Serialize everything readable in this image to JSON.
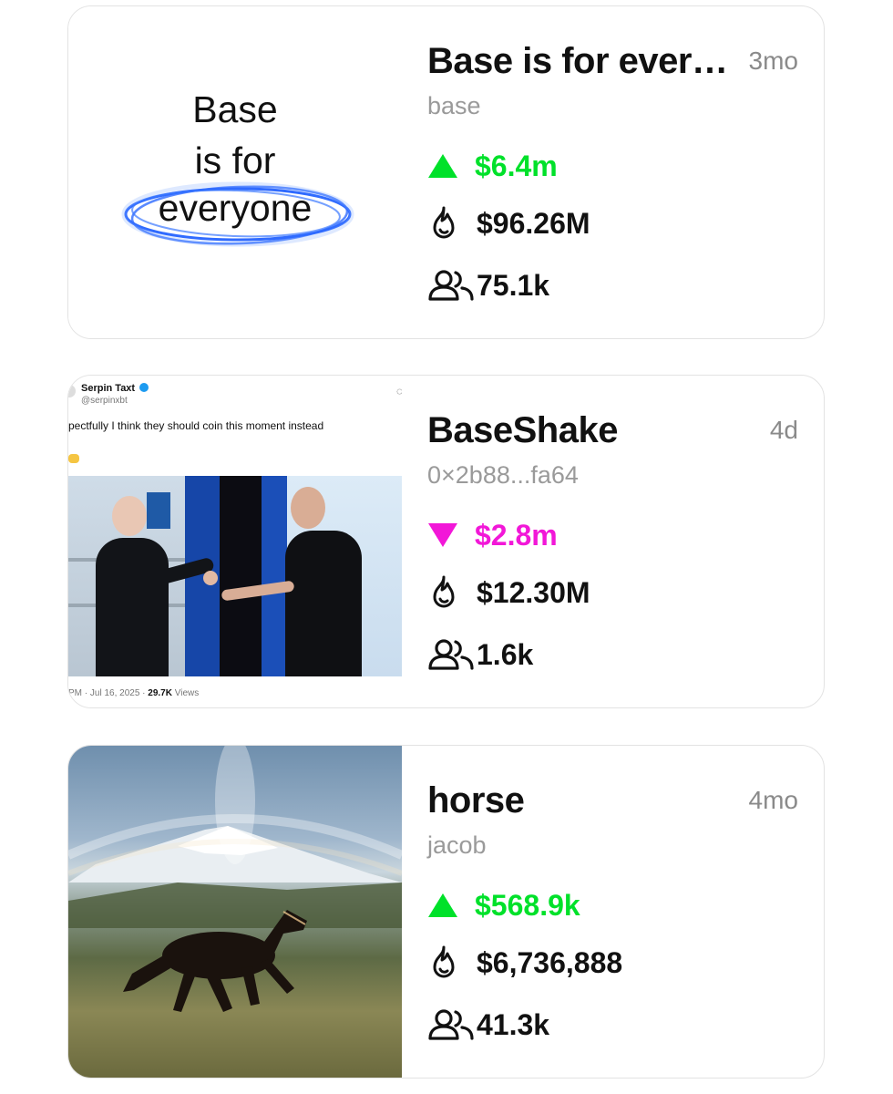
{
  "cards": [
    {
      "title": "Base is for every...",
      "age": "3mo",
      "creator": "base",
      "change": "$6.4m",
      "change_dir": "up",
      "burn": "$96.26M",
      "holders": "75.1k",
      "thumb": {
        "line1": "Base",
        "line2": "is for",
        "line3": "everyone"
      }
    },
    {
      "title": "BaseShake",
      "age": "4d",
      "creator": "0×2b88...fa64",
      "change": "$2.8m",
      "change_dir": "down",
      "burn": "$12.30M",
      "holders": "1.6k",
      "thumb": {
        "tweet_name": "Serpin Taxt",
        "tweet_handle": "@serpinxbt",
        "tweet_text": "pectfully I think they should coin this moment instead",
        "tweet_meta_prefix": "PM · Jul 16, 2025 · ",
        "tweet_views": "29.7K",
        "tweet_views_label": " Views"
      }
    },
    {
      "title": "horse",
      "age": "4mo",
      "creator": "jacob",
      "change": "$568.9k",
      "change_dir": "up",
      "burn": "$6,736,888",
      "holders": "41.3k"
    }
  ],
  "colors": {
    "up": "#00e12a",
    "down": "#f217d8",
    "muted": "#9a9a9a",
    "border": "#e3e3e3"
  },
  "icons": {
    "up": "triangle-up-icon",
    "down": "triangle-down-icon",
    "burn": "flame-icon",
    "holders": "users-icon",
    "verified": "verified-badge-icon"
  }
}
